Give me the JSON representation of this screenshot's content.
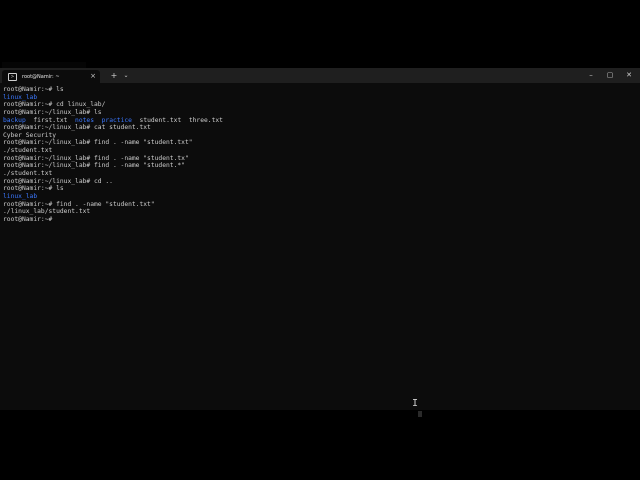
{
  "window": {
    "tab_title": "root@Namir: ~",
    "tab_icon": "terminal-icon",
    "tab_close": "×",
    "new_tab": "+",
    "dropdown": "⌄",
    "minimize": "–",
    "maximize": "▢",
    "close": "✕"
  },
  "terminal": {
    "lines": [
      [
        {
          "t": "root@Namir:~# ls"
        }
      ],
      [
        {
          "t": "linux_lab",
          "c": "dir"
        }
      ],
      [
        {
          "t": "root@Namir:~# cd linux_lab/"
        }
      ],
      [
        {
          "t": "root@Namir:~/linux_lab# ls"
        }
      ],
      [
        {
          "t": "backup",
          "c": "dir"
        },
        {
          "t": "  first.txt  "
        },
        {
          "t": "notes",
          "c": "dir"
        },
        {
          "t": "  "
        },
        {
          "t": "practice",
          "c": "dir"
        },
        {
          "t": "  student.txt  three.txt"
        }
      ],
      [
        {
          "t": "root@Namir:~/linux_lab# cat student.txt"
        }
      ],
      [
        {
          "t": "Cyber Security"
        }
      ],
      [
        {
          "t": "root@Namir:~/linux_lab# find . -name \"student.txt\""
        }
      ],
      [
        {
          "t": "./student.txt"
        }
      ],
      [
        {
          "t": "root@Namir:~/linux_lab# find . -name \"student.tx\""
        }
      ],
      [
        {
          "t": "root@Namir:~/linux_lab# find . -name \"student.*\""
        }
      ],
      [
        {
          "t": "./student.txt"
        }
      ],
      [
        {
          "t": "root@Namir:~/linux_lab# cd .."
        }
      ],
      [
        {
          "t": "root@Namir:~# ls"
        }
      ],
      [
        {
          "t": "linux_lab",
          "c": "dir"
        }
      ],
      [
        {
          "t": "root@Namir:~# find . -name \"student.txt\""
        }
      ],
      [
        {
          "t": "./linux_lab/student.txt"
        }
      ],
      [
        {
          "t": "root@Namir:~# "
        }
      ]
    ]
  },
  "colors": {
    "background": "#0c0c0c",
    "text": "#cccccc",
    "directory": "#3b78ff"
  },
  "mouse_cursor": "I"
}
